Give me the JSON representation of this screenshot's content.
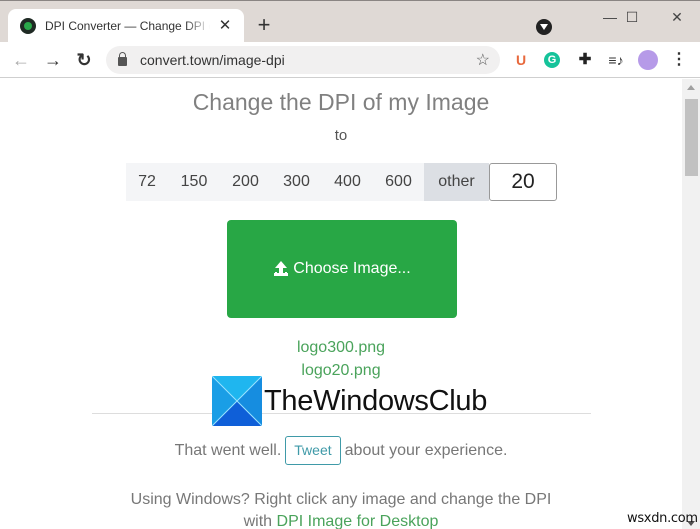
{
  "browser": {
    "tab_title": "DPI Converter — Change DPI of Image",
    "new_tab_label": "+",
    "close_tab_label": "✕",
    "url": "convert.town/image-dpi",
    "window_controls": {
      "minimize": "—",
      "maximize": "☐",
      "close": "✕"
    },
    "extensions": [
      "ublock-origin",
      "grammarly",
      "extensions-puzzle",
      "media-queue",
      "profile-avatar",
      "menu"
    ]
  },
  "page": {
    "heading": "Change the DPI of my Image",
    "to_label": "to",
    "dpi_options": [
      "72",
      "150",
      "200",
      "300",
      "400",
      "600",
      "other"
    ],
    "selected_option": "other",
    "custom_dpi_value": "20",
    "choose_button_label": "Choose Image...",
    "files": [
      "logo300.png",
      "logo20.png"
    ],
    "feedback_prefix": "That went well.",
    "tweet_label": "Tweet",
    "feedback_suffix": "about your experience.",
    "windows_note": "Using Windows? Right click any image and change the DPI",
    "windows_note_with": "with",
    "desktop_link": "DPI Image for Desktop"
  },
  "overlay": {
    "brand_watermark": "TheWindowsClub",
    "site_watermark": "wsxdn.com"
  },
  "colors": {
    "accent_green": "#28a745",
    "link_green": "#4aa35b",
    "tweet_teal": "#3f9aa8"
  }
}
